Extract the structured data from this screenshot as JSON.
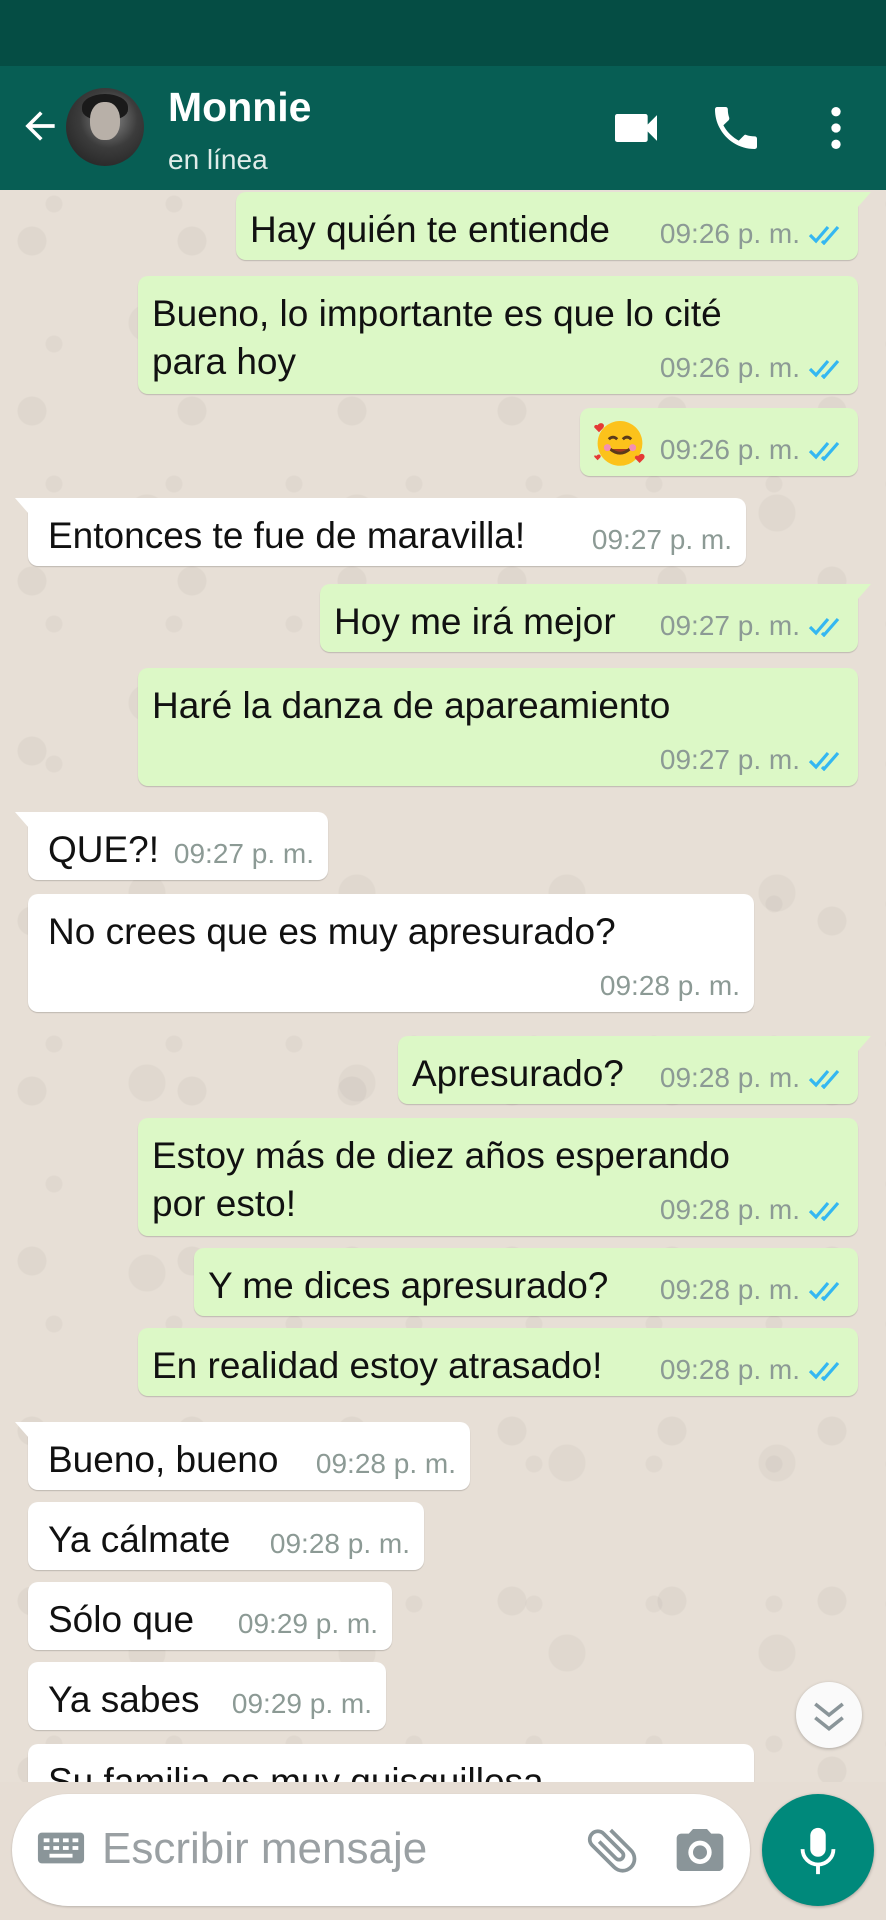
{
  "header": {
    "contact_name": "Monnie",
    "contact_status": "en línea"
  },
  "colors": {
    "appbar": "#075e54",
    "statusbar": "#054d44",
    "outgoing_bubble": "#dcf8c6",
    "incoming_bubble": "#ffffff",
    "read_ticks": "#34b7f1",
    "mic_button": "#00897b"
  },
  "icons": [
    "back-arrow-icon",
    "avatar",
    "video-call-icon",
    "voice-call-icon",
    "more-options-icon",
    "double-check-icon",
    "scroll-down-icon",
    "keyboard-icon",
    "attach-icon",
    "camera-icon",
    "mic-icon"
  ],
  "messages": [
    {
      "dir": "out",
      "text": "Hay quién te entiende",
      "time": "09:26 p. m."
    },
    {
      "dir": "out",
      "text": "Bueno, lo importante es que lo cité",
      "text2": "para hoy",
      "time": "09:26 p. m."
    },
    {
      "dir": "out",
      "emoji": "smiling-face-with-hearts",
      "time": "09:26 p. m."
    },
    {
      "dir": "in",
      "text": "Entonces te fue de maravilla!",
      "time": "09:27 p. m."
    },
    {
      "dir": "out",
      "text": "Hoy me irá mejor",
      "time": "09:27 p. m."
    },
    {
      "dir": "out",
      "text": "Haré la danza de apareamiento",
      "time": "09:27 p. m."
    },
    {
      "dir": "in",
      "text": "QUE?!",
      "time": "09:27 p. m."
    },
    {
      "dir": "in",
      "text": "No crees que es muy apresurado?",
      "time": "09:28 p. m."
    },
    {
      "dir": "out",
      "text": "Apresurado?",
      "time": "09:28 p. m."
    },
    {
      "dir": "out",
      "text": "Estoy más de diez años esperando",
      "text2": "por esto!",
      "time": "09:28 p. m."
    },
    {
      "dir": "out",
      "text": "Y me dices apresurado?",
      "time": "09:28 p. m."
    },
    {
      "dir": "out",
      "text": "En realidad estoy atrasado!",
      "time": "09:28 p. m."
    },
    {
      "dir": "in",
      "text": "Bueno, bueno",
      "time": "09:28 p. m."
    },
    {
      "dir": "in",
      "text": "Ya cálmate",
      "time": "09:28 p. m."
    },
    {
      "dir": "in",
      "text": "Sólo que",
      "time": "09:29 p. m."
    },
    {
      "dir": "in",
      "text": "Ya sabes",
      "time": "09:29 p. m."
    },
    {
      "dir": "in",
      "text": "Su familia es muy quisquillosa",
      "time": ""
    }
  ],
  "composer": {
    "placeholder": "Escribir mensaje"
  }
}
